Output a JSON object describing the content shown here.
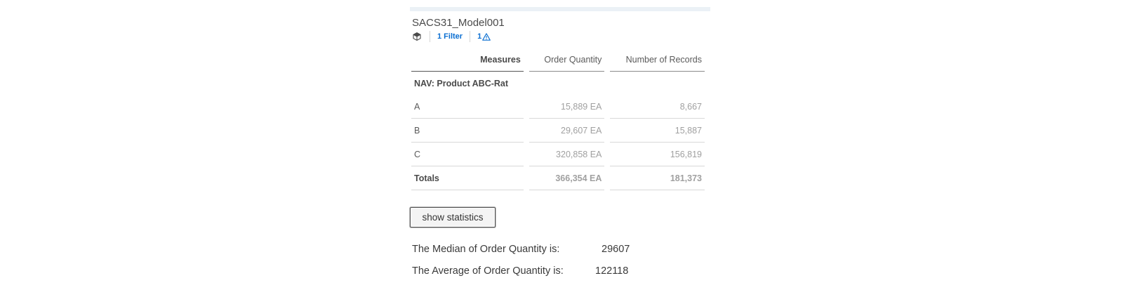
{
  "widget": {
    "title": "SACS31_Model001",
    "filter_label": "1 Filter",
    "warning_count": "1"
  },
  "table": {
    "headers": [
      "Measures",
      "Order Quantity",
      "Number of Records"
    ],
    "group_label": "NAV: Product ABC-Rat",
    "rows": [
      {
        "dim": "A",
        "order_quantity": "15,889 EA",
        "records": "8,667"
      },
      {
        "dim": "B",
        "order_quantity": "29,607 EA",
        "records": "15,887"
      },
      {
        "dim": "C",
        "order_quantity": "320,858 EA",
        "records": "156,819"
      }
    ],
    "totals": {
      "dim": "Totals",
      "order_quantity": "366,354 EA",
      "records": "181,373"
    }
  },
  "button": {
    "label": "show statistics"
  },
  "stats": {
    "median_label": "The Median of Order Quantity is:",
    "median_value": "29607",
    "average_label": "The Average of Order Quantity is:",
    "average_value": "122118"
  },
  "icons": {
    "model": "cube-icon",
    "warning": "warning-triangle-icon"
  },
  "colors": {
    "link": "#0a6ed1",
    "header_bar": "#ebf1f6"
  }
}
